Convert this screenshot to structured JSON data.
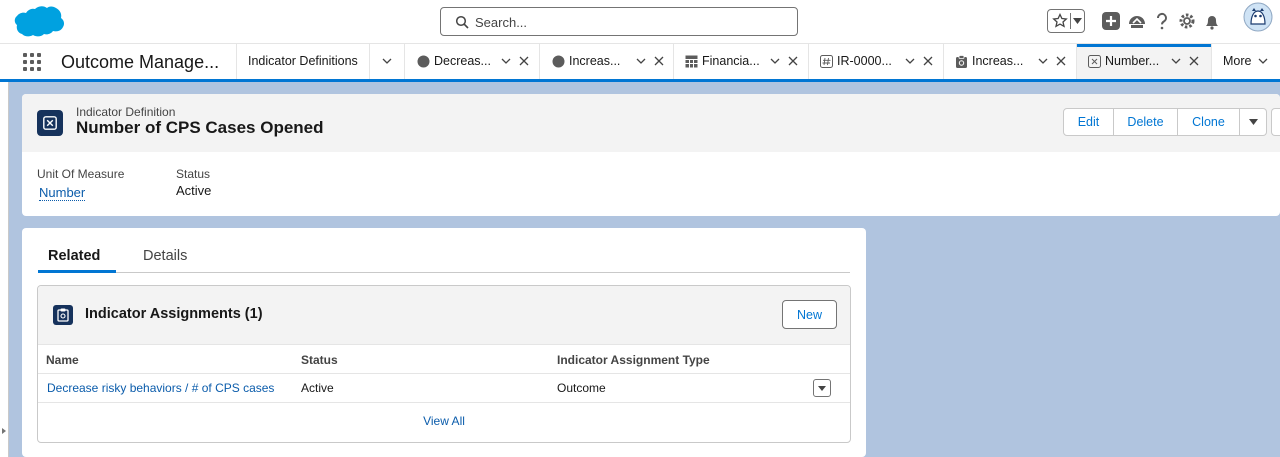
{
  "search": {
    "placeholder": "Search..."
  },
  "nav": {
    "app_name": "Outcome Manage...",
    "tabs": [
      {
        "label": "Indicator Definitions",
        "icon": "none"
      },
      {
        "label": "Decreas...",
        "icon": "circle-icon"
      },
      {
        "label": "Increas...",
        "icon": "circle-icon"
      },
      {
        "label": "Financia...",
        "icon": "table-icon"
      },
      {
        "label": "IR-0000...",
        "icon": "hash-icon"
      },
      {
        "label": "Increas...",
        "icon": "clipboard-icon"
      },
      {
        "label": "Number...",
        "icon": "indicator-icon"
      }
    ],
    "more_label": "More"
  },
  "record": {
    "type_label": "Indicator Definition",
    "title": "Number of CPS Cases Opened",
    "actions": {
      "edit": "Edit",
      "delete": "Delete",
      "clone": "Clone"
    },
    "fields": {
      "unit_label": "Unit Of Measure",
      "unit_value": "Number",
      "status_label": "Status",
      "status_value": "Active"
    }
  },
  "related": {
    "tabs": {
      "related": "Related",
      "details": "Details"
    },
    "list": {
      "title": "Indicator Assignments (1)",
      "new_label": "New",
      "columns": [
        "Name",
        "Status",
        "Indicator Assignment Type"
      ],
      "rows": [
        {
          "name": "Decrease risky behaviors / # of CPS cases",
          "status": "Active",
          "type": "Outcome"
        }
      ],
      "view_all": "View All"
    }
  },
  "colors": {
    "brand": "#0176d3",
    "link": "#0b5cab",
    "icon_bg": "#16325c",
    "background": "#b0c4df"
  }
}
